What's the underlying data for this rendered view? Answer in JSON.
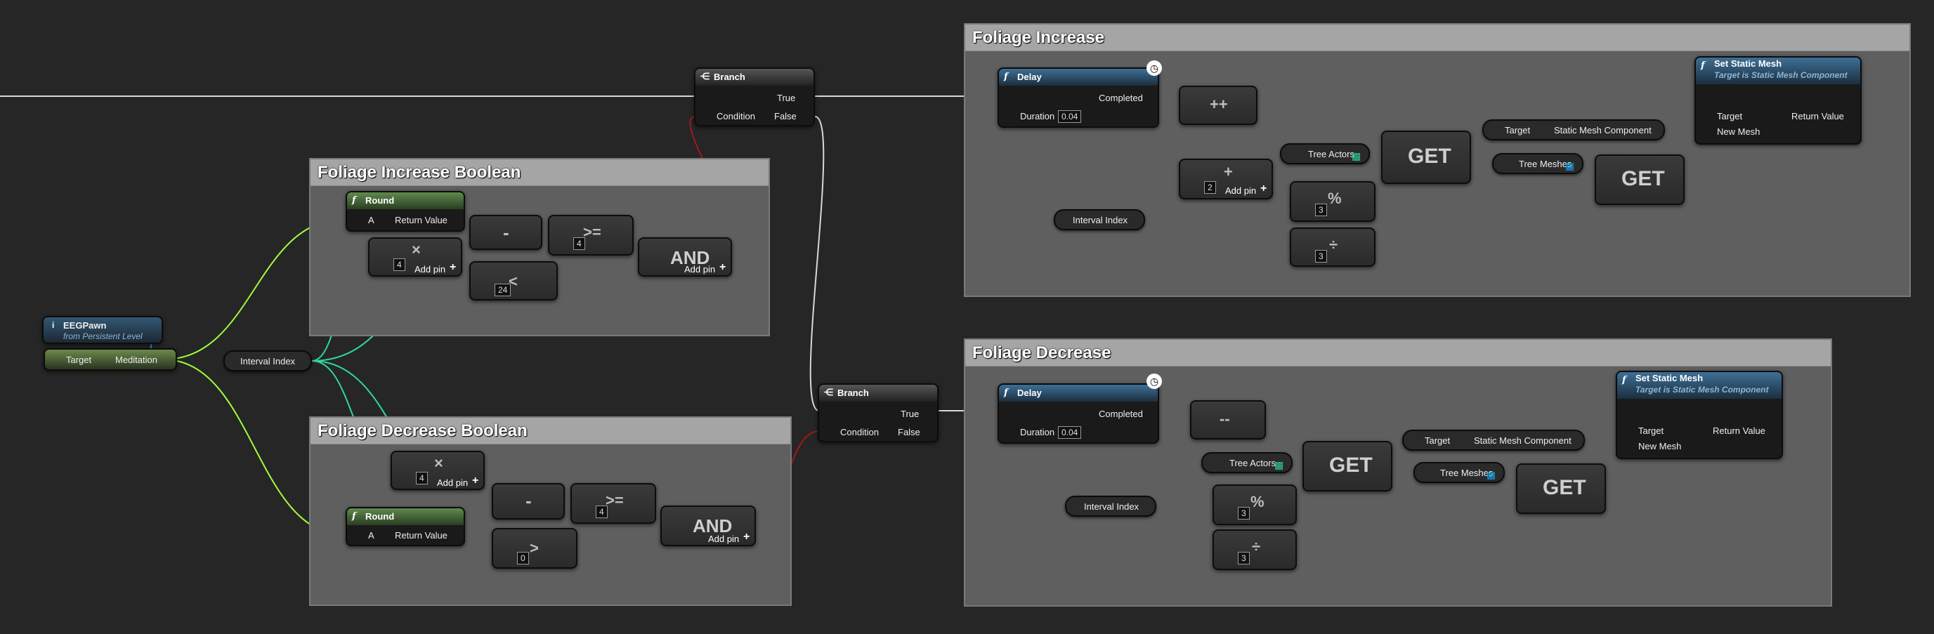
{
  "colors": {
    "background": "#262626",
    "exec": "#ffffff",
    "float": "#9fff3a",
    "int": "#2ed6a3",
    "bool": "#9b1c1c",
    "object": "#16a0e8",
    "comment_body": "#5f5f5f",
    "comment_title": "#a5a5a5"
  },
  "comments": {
    "foliage_increase_boolean": "Foliage Increase Boolean",
    "foliage_decrease_boolean": "Foliage Decrease Boolean",
    "foliage_increase": "Foliage Increase",
    "foliage_decrease": "Foliage Decrease"
  },
  "eegpawn": {
    "title": "EEGPawn",
    "subtitle": "from Persistent Level"
  },
  "meditation": {
    "target": "Target",
    "output": "Meditation"
  },
  "interval_index": "Interval Index",
  "round": {
    "title": "Round",
    "input": "A",
    "output": "Return Value"
  },
  "ops": {
    "multiply": "×",
    "minus": "-",
    "gte": ">=",
    "lt": "<",
    "gt": ">",
    "and": "AND",
    "increment": "++",
    "decrement": "--",
    "plus": "+",
    "mod": "%",
    "divide": "÷",
    "get": "GET",
    "add_pin": "Add pin"
  },
  "values": {
    "four": "4",
    "twentyfour": "24",
    "zero": "0",
    "two": "2",
    "three": "3",
    "duration": "0.04"
  },
  "branch": {
    "title": "Branch",
    "condition": "Condition",
    "true_label": "True",
    "false_label": "False"
  },
  "delay": {
    "title": "Delay",
    "completed": "Completed",
    "duration": "Duration"
  },
  "set_static_mesh": {
    "title": "Set Static Mesh",
    "subtitle": "Target is Static Mesh Component",
    "target": "Target",
    "new_mesh": "New Mesh",
    "return_value": "Return Value"
  },
  "tree_actors": "Tree Actors",
  "tree_meshes": "Tree Meshes",
  "static_mesh_target": {
    "target": "Target",
    "output": "Static Mesh Component"
  }
}
